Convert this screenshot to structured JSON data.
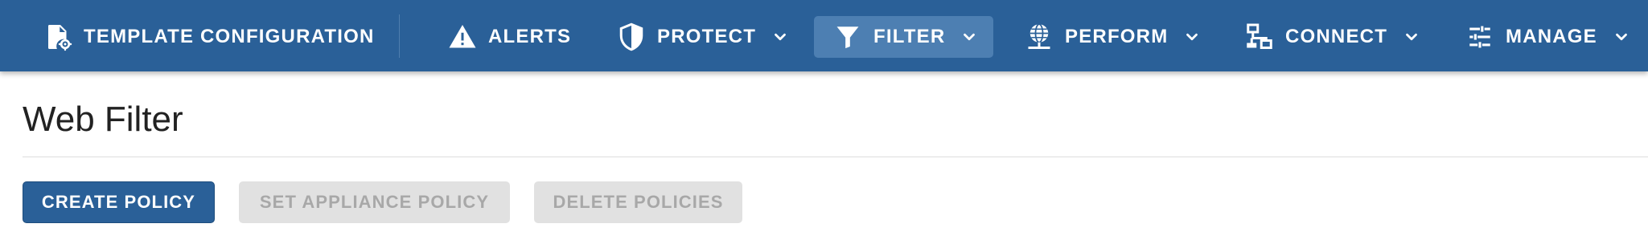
{
  "nav": {
    "template_config": {
      "label": "TEMPLATE CONFIGURATION",
      "icon": "file-gear-icon"
    },
    "alerts": {
      "label": "ALERTS",
      "icon": "warning-triangle-icon"
    },
    "protect": {
      "label": "PROTECT",
      "icon": "shield-icon"
    },
    "filter": {
      "label": "FILTER",
      "icon": "funnel-icon",
      "active": true
    },
    "perform": {
      "label": "PERFORM",
      "icon": "globe-network-icon"
    },
    "connect": {
      "label": "CONNECT",
      "icon": "network-nodes-icon"
    },
    "manage": {
      "label": "MANAGE",
      "icon": "sliders-icon"
    }
  },
  "page": {
    "title": "Web Filter"
  },
  "actions": {
    "create_policy": "CREATE POLICY",
    "set_appliance_policy": "SET APPLIANCE POLICY",
    "delete_policies": "DELETE POLICIES"
  },
  "colors": {
    "topbar": "#2a6098",
    "active_tab": "#4d7fb2",
    "primary_button": "#2a6098",
    "disabled_button": "#e1e1e1",
    "disabled_text": "#a8a8a8"
  }
}
